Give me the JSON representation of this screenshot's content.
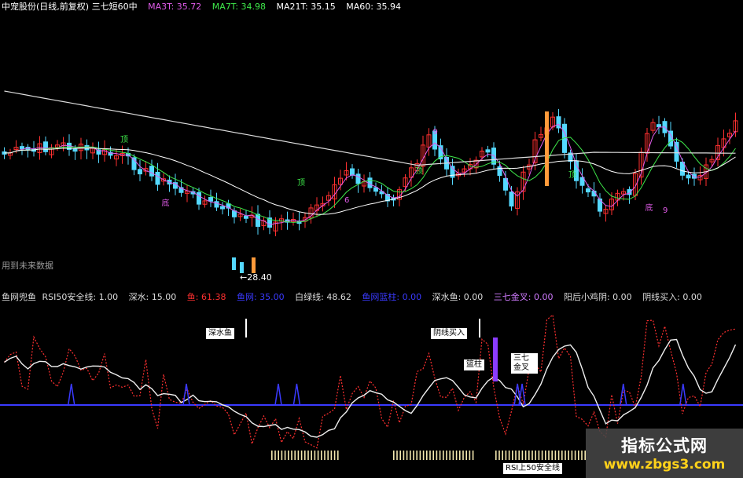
{
  "header": {
    "title": "中宠股份(日线,前复权) 三七短60中",
    "ma": [
      {
        "label": "MA3T: 35.72",
        "color": "#e05be8"
      },
      {
        "label": "MA7T: 34.98",
        "color": "#3ee84a"
      },
      {
        "label": "MA21T: 35.15",
        "color": "#ffffff"
      },
      {
        "label": "MA60: 35.94",
        "color": "#ffffff"
      }
    ]
  },
  "price_panel": {
    "future_data_note": "用到未来数据",
    "low_label": "←28.40",
    "markers": {
      "top": "顶",
      "bottom": "底",
      "nine": "9",
      "six": "6"
    }
  },
  "indicator_header": [
    {
      "label": "鱼网兜鱼",
      "color": "#dddddd"
    },
    {
      "label": "RSI50安全线: 1.00",
      "color": "#dddddd"
    },
    {
      "label": "深水: 15.00",
      "color": "#dddddd"
    },
    {
      "label": "鱼: 61.38",
      "color": "#ff3030"
    },
    {
      "label": "鱼网: 35.00",
      "color": "#3a3aff"
    },
    {
      "label": "白绿线: 48.62",
      "color": "#dddddd"
    },
    {
      "label": "鱼网篮柱: 0.00",
      "color": "#3a3aff"
    },
    {
      "label": "深水鱼: 0.00",
      "color": "#dddddd"
    },
    {
      "label": "三七金叉: 0.00",
      "color": "#d07bff"
    },
    {
      "label": "阳后小鸡阴: 0.00",
      "color": "#dddddd"
    },
    {
      "label": "阴线买入: 0.00",
      "color": "#dddddd"
    }
  ],
  "indicator_panel": {
    "shenshuiyu_label": "深水鱼",
    "yinxian_label": "阴线买入",
    "lanzhu_label": "篮柱",
    "sanqi_label": "三七金叉",
    "rsi_safe_label": "RSI上50安全线"
  },
  "colors": {
    "up": "#ff3030",
    "down": "#54d8ff",
    "ma3": "#e05be8",
    "ma7": "#3ee84a",
    "ma21": "#ffffff",
    "fishnet": "#3a3aff",
    "fish": "#ff3030"
  },
  "watermark": {
    "line1": "指标公式网",
    "line2": "www.zbgs3.com"
  }
}
